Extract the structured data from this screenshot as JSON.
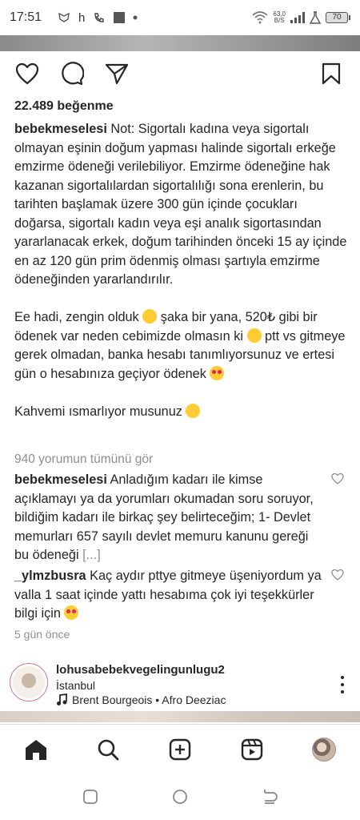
{
  "status_bar": {
    "time": "17:51",
    "letter": "h",
    "net_speed_value": "63,0",
    "net_speed_unit": "B/S",
    "battery": "70"
  },
  "actions": {
    "like_icon": "heart-outline-icon",
    "comment_icon": "comment-bubble-icon",
    "share_icon": "send-paper-plane-icon",
    "save_icon": "bookmark-icon"
  },
  "post": {
    "likes": "22.489 beğenme",
    "caption_user": "bebekmeselesi",
    "caption_p1": " Not: Sigortalı kadına veya sigortalı olmayan eşinin doğum yapması halinde sigortalı erkeğe emzirme ödeneği verilebiliyor. Emzirme ödeneğine hak kazanan sigortalılardan sigortalılığı sona erenlerin, bu tarihten başlamak üzere 300 gün içinde çocukları doğarsa, sigortalı kadın veya eşi analık sigortasından yararlanacak erkek, doğum tarihinden önceki 15 ay içinde en az 120 gün prim ödenmiş olması şartıyla emzirme ödeneğinden yararlandırılır.",
    "caption_p2a": "Ee hadi, zengin olduk ",
    "caption_p2b": " şaka bir yana, 520₺ gibi bir ödenek var neden cebimizde olmasın ki ",
    "caption_p2c": " ptt vs gitmeye gerek olmadan, banka hesabı tanımlıyorsunuz ve ertesi gün o hesabınıza geçiyor ödenek ",
    "caption_p3": "Kahvemi ısmarlıyor musunuz "
  },
  "comments": {
    "view_all": "940 yorumun tümünü gör",
    "items": [
      {
        "user": "bebekmeselesi",
        "text": " Anladığım kadarı ile kimse açıklamayı ya da yorumları okumadan soru soruyor, bildiğim kadarı ile birkaç şey belirteceğim; 1- Devlet memurları 657 sayılı devlet memuru kanunu gereği bu ödeneği ",
        "more": "[...]"
      },
      {
        "user": "_ylmzbusra",
        "text": " Kaç aydır pttye gitmeye üşeniyordum ya valla 1 saat içinde yattı hesabıma çok iyi teşekkürler bilgi için "
      }
    ],
    "time_ago": "5 gün önce"
  },
  "account": {
    "name": "lohusabebekvegelingunlugu2",
    "location": "İstanbul",
    "music": "Brent Bourgeois • Afro Deeziac"
  },
  "bottom_nav": [
    "home-icon",
    "search-icon",
    "create-post-icon",
    "reels-icon",
    "profile-avatar"
  ],
  "colors": {
    "text": "#262626",
    "muted": "#8e8e8e",
    "heart": "#e0245e"
  }
}
